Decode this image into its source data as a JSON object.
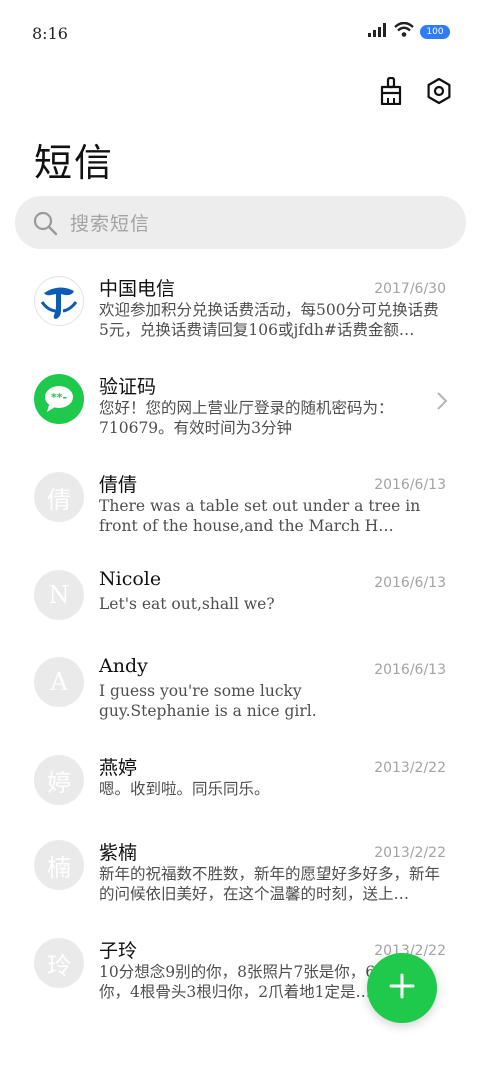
{
  "status": {
    "time": "8:16",
    "battery": "100"
  },
  "header": {
    "title": "短信"
  },
  "search": {
    "placeholder": "搜索短信"
  },
  "conversations": [
    {
      "avatar": "",
      "avatar_type": "china-telecom-logo",
      "name": "中国电信",
      "date": "2017/6/30",
      "message": "欢迎参加积分兑换话费活动，每500分可兑换话费5元，兑换话费请回复106或jfdh#话费金额…"
    },
    {
      "avatar": "",
      "avatar_type": "message-bubble-icon",
      "name": "验证码",
      "date": "",
      "message": "您好！您的网上营业厅登录的随机密码为：710679。有效时间为3分钟"
    },
    {
      "avatar": "倩",
      "name": "倩倩",
      "date": "2016/6/13",
      "message": "There was a table set out under a tree in front of the house,and the March H…"
    },
    {
      "avatar": "N",
      "name": "Nicole",
      "date": "2016/6/13",
      "message": "Let's eat out,shall we?"
    },
    {
      "avatar": "A",
      "name": "Andy",
      "date": "2016/6/13",
      "message": "I guess you're some lucky guy.Stephanie is a nice girl."
    },
    {
      "avatar": "婷",
      "name": "燕婷",
      "date": "2013/2/22",
      "message": "嗯。收到啦。同乐同乐。"
    },
    {
      "avatar": "楠",
      "name": "紫楠",
      "date": "2013/2/22",
      "message": "新年的祝福数不胜数，新年的愿望好多好多，新年的问候依旧美好，在这个温馨的时刻，送上…"
    },
    {
      "avatar": "玲",
      "name": "子玲",
      "date": "2013/2/22",
      "message": "10分想念9别的你，8张照片7张是你，6…只像你，4根骨头3根归你，2爪着地1定是…"
    }
  ],
  "colors": {
    "accent": "#1ec94c",
    "telecom_blue": "#0d5bb5",
    "battery": "#2f7cf6"
  }
}
